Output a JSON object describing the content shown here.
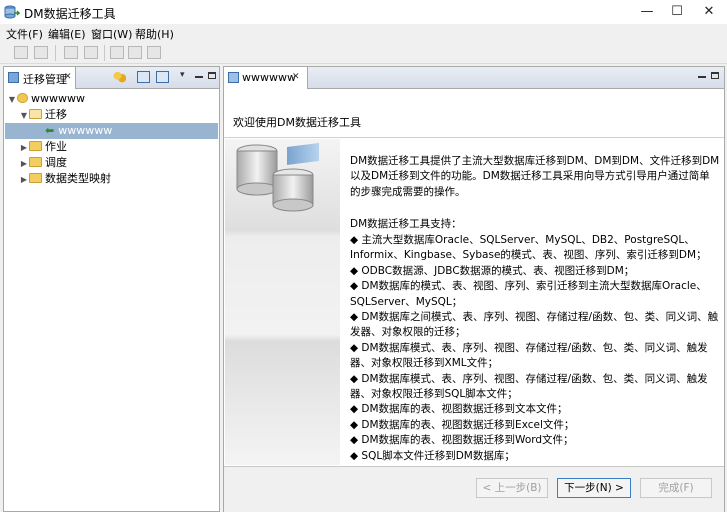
{
  "window": {
    "title": "DM数据迁移工具",
    "minimize": "—",
    "maximize": "☐",
    "close": "✕"
  },
  "menu": [
    "文件(F)",
    "编辑(E)",
    "窗口(W)",
    "帮助(H)"
  ],
  "left_view": {
    "tab_label": "迁移管理",
    "tree": [
      {
        "label": "wwwwww",
        "level": 0,
        "expanded": true
      },
      {
        "label": "迁移",
        "level": 1,
        "expanded": true
      },
      {
        "label": "wwwwww",
        "level": 2,
        "selected": true
      },
      {
        "label": "作业",
        "level": 1
      },
      {
        "label": "调度",
        "level": 1
      },
      {
        "label": "数据类型映射",
        "level": 1
      }
    ]
  },
  "editor": {
    "tab_label": "wwwwww",
    "welcome": "欢迎使用DM数据迁移工具",
    "intro": "DM数据迁移工具提供了主流大型数据库迁移到DM、DM到DM、文件迁移到DM以及DM迁移到文件的功能。DM数据迁移工具采用向导方式引导用户通过简单的步骤完成需要的操作。",
    "support_title": "DM数据迁移工具支持：",
    "features": [
      "◆ 主流大型数据库Oracle、SQLServer、MySQL、DB2、PostgreSQL、Informix、Kingbase、Sybase的模式、表、视图、序列、索引迁移到DM；",
      "◆ ODBC数据源、JDBC数据源的模式、表、视图迁移到DM；",
      "◆ DM数据库的模式、表、视图、序列、索引迁移到主流大型数据库Oracle、SQLServer、MySQL；",
      "◆ DM数据库之间模式、表、序列、视图、存储过程/函数、包、类、同义词、触发器、对象权限的迁移；",
      "◆ DM数据库模式、表、序列、视图、存储过程/函数、包、类、同义词、触发器、对象权限迁移到XML文件；",
      "◆ DM数据库模式、表、序列、视图、存储过程/函数、包、类、同义词、触发器、对象权限迁移到SQL脚本文件；",
      "◆ DM数据库的表、视图数据迁移到文本文件；",
      "◆ DM数据库的表、视图数据迁移到Excel文件；",
      "◆ DM数据库的表、视图数据迁移到Word文件；",
      "◆ SQL脚本文件迁移到DM数据库；"
    ],
    "buttons": {
      "back": "< 上一步(B)",
      "next": "下一步(N) >",
      "finish": "完成(F)"
    }
  },
  "colors": {
    "selection": "#99b4d1",
    "tab_active_bg": "#ffffff",
    "accent": "#3a7fc3"
  }
}
